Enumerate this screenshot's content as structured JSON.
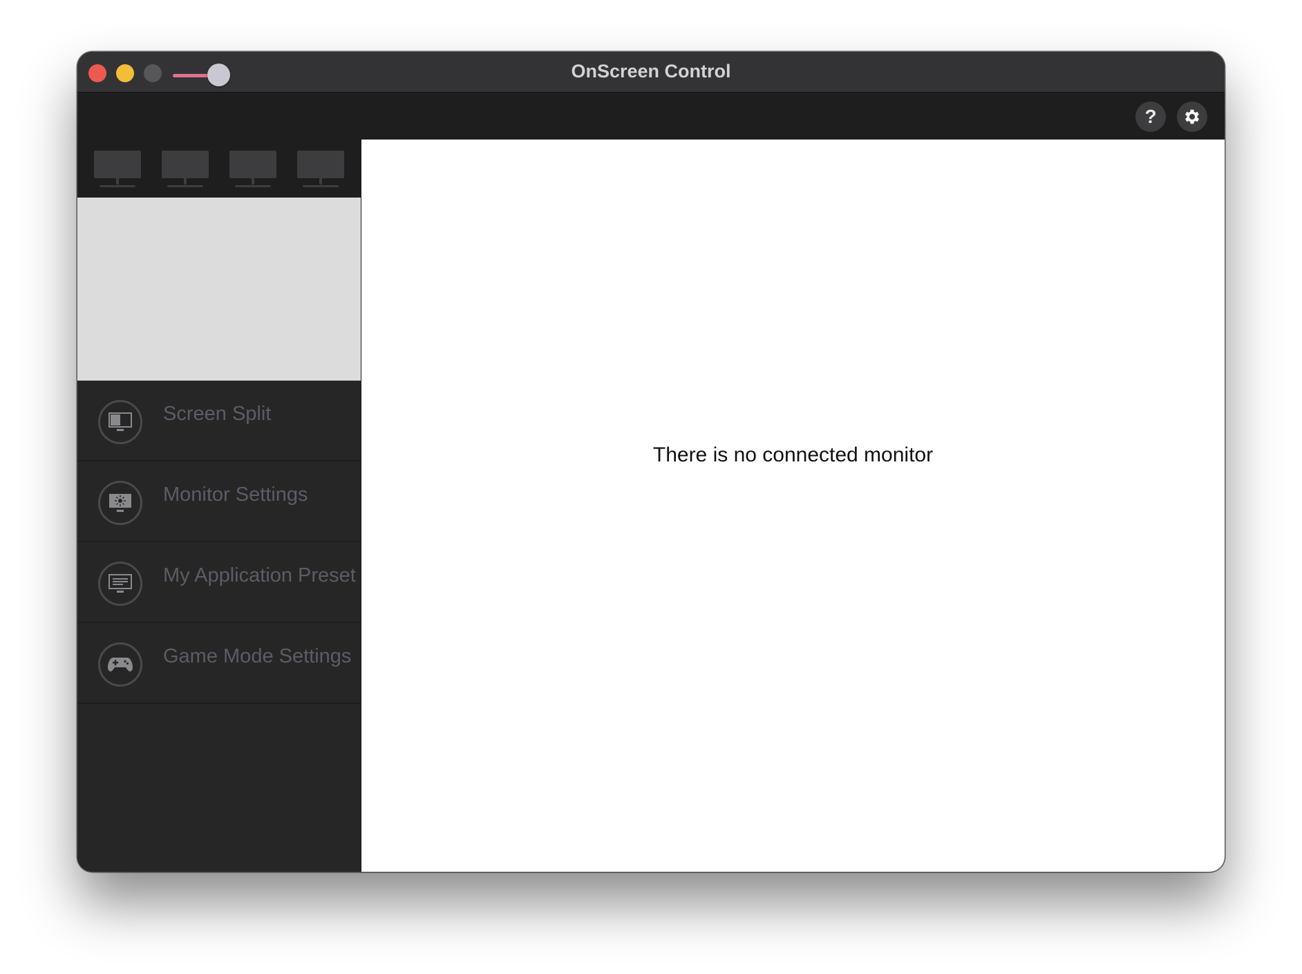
{
  "window": {
    "title": "OnScreen Control",
    "traffic_lights": [
      "close",
      "minimize",
      "zoom"
    ]
  },
  "titlebar": {
    "slider": {
      "value": 0.75,
      "accent": "#e0728a"
    }
  },
  "toolbar": {
    "help_glyph": "?",
    "help_icon": "question-icon",
    "settings_icon": "gear-icon"
  },
  "monitor_strip": {
    "monitors": [
      "monitor-1",
      "monitor-2",
      "monitor-3",
      "monitor-4"
    ]
  },
  "sidebar": {
    "items": [
      {
        "label": "Screen Split",
        "icon": "screen-split-icon"
      },
      {
        "label": "Monitor Settings",
        "icon": "monitor-settings-icon"
      },
      {
        "label": "My Application Preset",
        "icon": "application-preset-icon"
      },
      {
        "label": "Game Mode Settings",
        "icon": "gamepad-icon"
      }
    ]
  },
  "main": {
    "message": "There is no connected monitor"
  },
  "colors": {
    "titlebar": "#333336",
    "sidebar": "#262627",
    "preview": "#dcdcdc",
    "sidebar_text": "#5c5c66"
  }
}
